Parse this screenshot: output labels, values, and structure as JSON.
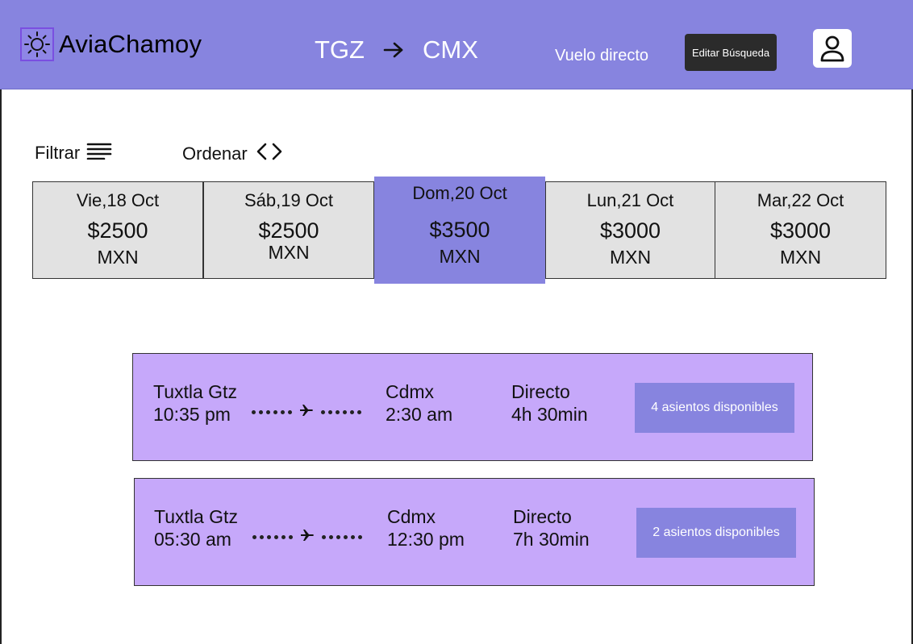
{
  "header": {
    "brand": "AviaChamoy",
    "brand_icon": "sun-icon",
    "origin": "TGZ",
    "destination": "CMX",
    "trip_type": "Vuelo directo",
    "edit_label": "Editar Búsqueda",
    "user_icon": "user-icon"
  },
  "toolbar": {
    "filter_label": "Filtrar",
    "filter_icon": "filter-lines-icon",
    "sort_label": "Ordenar",
    "sort_icon": "chevrons-left-right-icon"
  },
  "dates": [
    {
      "label": "Vie,18 Oct",
      "price": "$2500",
      "currency": "MXN",
      "selected": false
    },
    {
      "label": "Sáb,19 Oct",
      "price": "$2500",
      "currency": "MXN",
      "selected": false
    },
    {
      "label": "Dom,20 Oct",
      "price": "$3500",
      "currency": "MXN",
      "selected": true
    },
    {
      "label": "Lun,21 Oct",
      "price": "$3000",
      "currency": "MXN",
      "selected": false
    },
    {
      "label": "Mar,22 Oct",
      "price": "$3000",
      "currency": "MXN",
      "selected": false
    }
  ],
  "flights": [
    {
      "from": "Tuxtla Gtz",
      "depart": "10:35 pm",
      "to": "Cdmx",
      "arrive": "2:30 am",
      "type": "Directo",
      "duration": "4h 30min",
      "seats": "4 asientos disponibles"
    },
    {
      "from": "Tuxtla Gtz",
      "depart": "05:30 am",
      "to": "Cdmx",
      "arrive": "12:30 pm",
      "type": "Directo",
      "duration": "7h 30min",
      "seats": "2 asientos disponibles"
    }
  ],
  "colors": {
    "accent": "#8784df",
    "card": "#c6a8fa",
    "date_bg": "#e2e2e2",
    "button_dark": "#2b2b2b"
  }
}
